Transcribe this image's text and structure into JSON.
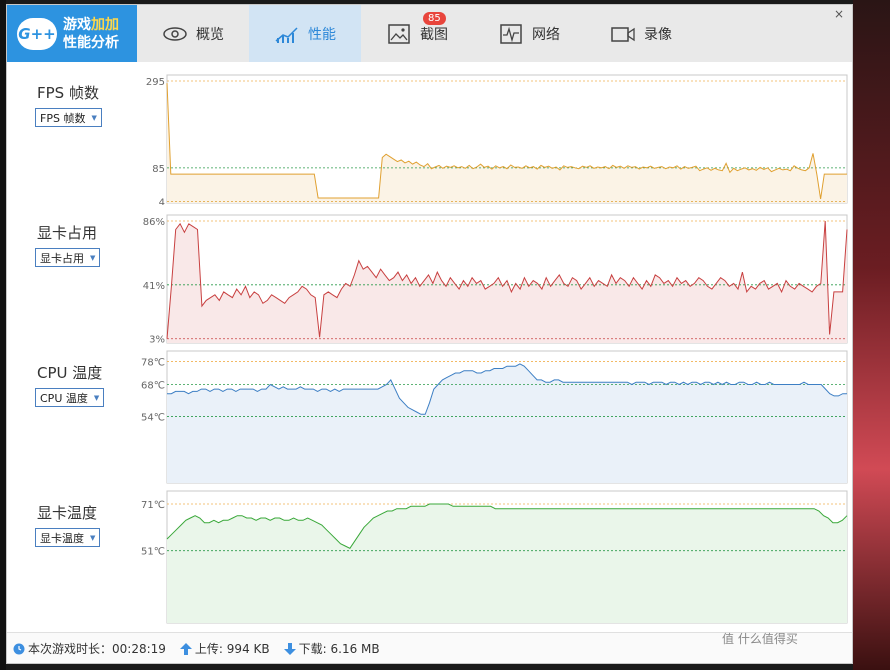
{
  "app": {
    "logo_mark": "G++",
    "logo_line1_a": "游戏",
    "logo_line1_b": "加加",
    "logo_line2": "性能分析",
    "close_glyph": "×"
  },
  "tabs": [
    {
      "label": "概览",
      "icon": "eye-icon"
    },
    {
      "label": "性能",
      "icon": "performance-chart-icon",
      "active": true
    },
    {
      "label": "截图",
      "icon": "image-icon",
      "badge": "85"
    },
    {
      "label": "网络",
      "icon": "pulse-icon"
    },
    {
      "label": "录像",
      "icon": "video-camera-icon"
    }
  ],
  "colors": {
    "accent": "#2d93e0",
    "fps": "#e0a030",
    "gpu_usage": "#c84040",
    "cpu_temp": "#3d7fc4",
    "gpu_temp": "#3aa83a"
  },
  "panels": {
    "fps": {
      "label": "FPS 帧数",
      "select": "FPS 帧数"
    },
    "gpu_usage": {
      "label": "显卡占用",
      "select": "显卡占用"
    },
    "cpu_temp": {
      "label": "CPU 温度",
      "select": "CPU 温度"
    },
    "gpu_temp": {
      "label": "显卡温度",
      "select": "显卡温度"
    }
  },
  "chart_data": [
    {
      "type": "area",
      "ylabel": "FPS 帧数",
      "ticks": [
        "295",
        "85",
        "4"
      ],
      "tick_values": [
        295,
        85,
        4
      ],
      "ylim": [
        0,
        295
      ],
      "values": [
        290,
        70,
        70,
        70,
        70,
        70,
        70,
        70,
        70,
        70,
        70,
        70,
        70,
        70,
        70,
        70,
        70,
        70,
        70,
        70,
        70,
        70,
        70,
        70,
        70,
        70,
        70,
        70,
        70,
        70,
        70,
        70,
        70,
        70,
        70,
        70,
        70,
        70,
        70,
        70,
        12,
        12,
        12,
        12,
        12,
        12,
        12,
        12,
        12,
        12,
        12,
        12,
        12,
        12,
        12,
        12,
        12,
        110,
        118,
        112,
        106,
        100,
        104,
        97,
        101,
        94,
        99,
        92,
        88,
        95,
        83,
        87,
        91,
        84,
        89,
        86,
        90,
        85,
        88,
        84,
        91,
        83,
        87,
        94,
        86,
        89,
        82,
        90,
        85,
        88,
        83,
        92,
        86,
        87,
        84,
        90,
        85,
        88,
        82,
        91,
        86,
        89,
        84,
        87,
        80,
        90,
        86,
        88,
        85,
        83,
        89,
        86,
        90,
        84,
        87,
        85,
        88,
        83,
        91,
        86,
        89,
        84,
        90,
        86,
        88,
        82,
        87,
        85,
        89,
        84,
        86,
        88,
        83,
        87,
        85,
        90,
        82,
        88,
        84,
        86,
        89,
        78,
        82,
        85,
        79,
        84,
        80,
        78,
        96,
        74,
        84,
        78,
        82,
        85,
        80,
        83,
        79,
        86,
        81,
        85,
        76,
        80,
        84,
        80,
        82,
        78,
        90,
        84,
        80,
        78,
        85,
        120,
        70,
        10,
        70,
        70,
        70,
        70,
        70,
        70,
        70
      ],
      "grid": true
    },
    {
      "type": "area",
      "ylabel": "显卡占用",
      "ticks": [
        "86%",
        "41%",
        "3%"
      ],
      "tick_values": [
        86,
        41,
        3
      ],
      "ylim": [
        0,
        86
      ],
      "values": [
        3,
        40,
        80,
        84,
        78,
        84,
        82,
        80,
        26,
        30,
        32,
        34,
        30,
        36,
        34,
        32,
        38,
        34,
        40,
        32,
        36,
        34,
        28,
        30,
        34,
        32,
        30,
        28,
        32,
        34,
        36,
        40,
        38,
        34,
        32,
        4,
        34,
        36,
        34,
        32,
        38,
        42,
        40,
        48,
        58,
        52,
        54,
        50,
        46,
        52,
        48,
        44,
        46,
        50,
        44,
        48,
        42,
        46,
        40,
        44,
        48,
        42,
        50,
        44,
        40,
        46,
        42,
        38,
        44,
        40,
        46,
        42,
        44,
        38,
        40,
        42,
        46,
        40,
        44,
        36,
        42,
        38,
        46,
        40,
        44,
        42,
        38,
        46,
        40,
        44,
        48,
        42,
        40,
        46,
        44,
        38,
        42,
        46,
        40,
        44,
        42,
        40,
        48,
        42,
        46,
        44,
        40,
        46,
        42,
        38,
        44,
        40,
        48,
        46,
        42,
        44,
        40,
        46,
        42,
        44,
        40,
        42,
        46,
        44,
        40,
        38,
        42,
        46,
        44,
        40,
        42,
        38,
        50,
        36,
        40,
        38,
        42,
        44,
        38,
        40,
        42,
        36,
        44,
        40,
        38,
        42,
        40,
        38,
        36,
        40,
        42,
        86,
        6,
        36,
        36,
        36,
        80
      ],
      "grid": true
    },
    {
      "type": "area",
      "ylabel": "CPU 温度",
      "ticks": [
        "78℃",
        "68℃",
        "54℃"
      ],
      "tick_values": [
        78,
        68,
        54
      ],
      "ylim": [
        25,
        80
      ],
      "values": [
        64,
        64,
        65,
        65,
        65,
        64,
        65,
        65,
        66,
        66,
        65,
        66,
        66,
        65,
        66,
        66,
        65,
        66,
        66,
        66,
        66,
        65,
        66,
        66,
        68,
        67,
        66,
        67,
        66,
        66,
        66,
        67,
        66,
        66,
        66,
        65,
        66,
        66,
        65,
        66,
        65,
        66,
        66,
        66,
        66,
        66,
        66,
        66,
        66,
        66,
        67,
        68,
        70,
        66,
        62,
        60,
        58,
        57,
        56,
        55,
        55,
        60,
        66,
        68,
        70,
        71,
        72,
        73,
        73,
        74,
        74,
        74,
        73,
        73,
        74,
        74,
        75,
        75,
        75,
        76,
        76,
        76,
        77,
        76,
        74,
        72,
        70,
        70,
        69,
        69,
        70,
        70,
        69,
        69,
        69,
        69,
        69,
        69,
        69,
        69,
        69,
        69,
        69,
        69,
        69,
        69,
        69,
        69,
        68,
        69,
        69,
        69,
        68,
        69,
        69,
        69,
        68,
        69,
        69,
        68,
        69,
        68,
        69,
        69,
        68,
        69,
        69,
        68,
        69,
        68,
        69,
        68,
        68,
        69,
        69,
        68,
        68,
        69,
        68,
        68,
        69,
        68,
        68,
        68,
        68,
        68,
        68,
        68,
        69,
        68,
        68,
        68,
        68,
        66,
        64,
        63,
        63,
        64,
        64
      ],
      "grid": true
    },
    {
      "type": "area",
      "ylabel": "显卡温度",
      "ticks": [
        "71℃",
        "51℃"
      ],
      "tick_values": [
        71,
        51
      ],
      "ylim": [
        20,
        74
      ],
      "values": [
        56,
        58,
        60,
        62,
        64,
        65,
        66,
        65,
        63,
        63,
        64,
        63,
        64,
        64,
        65,
        66,
        66,
        65,
        65,
        64,
        65,
        65,
        64,
        65,
        65,
        64,
        64,
        65,
        64,
        64,
        65,
        64,
        63,
        62,
        60,
        58,
        56,
        54,
        53,
        52,
        55,
        58,
        61,
        63,
        65,
        66,
        67,
        68,
        68,
        69,
        69,
        69,
        70,
        70,
        70,
        70,
        71,
        71,
        71,
        71,
        71,
        70,
        70,
        70,
        70,
        70,
        70,
        70,
        70,
        70,
        69,
        69,
        69,
        69,
        69,
        69,
        69,
        69,
        69,
        69,
        69,
        69,
        69,
        69,
        69,
        69,
        69,
        69,
        69,
        69,
        69,
        69,
        69,
        69,
        69,
        69,
        69,
        69,
        69,
        69,
        69,
        69,
        69,
        69,
        69,
        69,
        69,
        69,
        69,
        69,
        69,
        69,
        69,
        69,
        69,
        69,
        69,
        69,
        69,
        69,
        69,
        69,
        69,
        69,
        69,
        69,
        69,
        69,
        69,
        69,
        69,
        69,
        69,
        69,
        69,
        69,
        69,
        69,
        69,
        68,
        66,
        65,
        63,
        63,
        64,
        66
      ],
      "grid": true
    }
  ],
  "status": {
    "session_label": "本次游戏时长：",
    "session_value": "00:28:19",
    "upload_label": "上传:",
    "upload_value": "994 KB",
    "download_label": "下载:",
    "download_value": "6.16 MB"
  },
  "watermark": "值 什么值得买"
}
